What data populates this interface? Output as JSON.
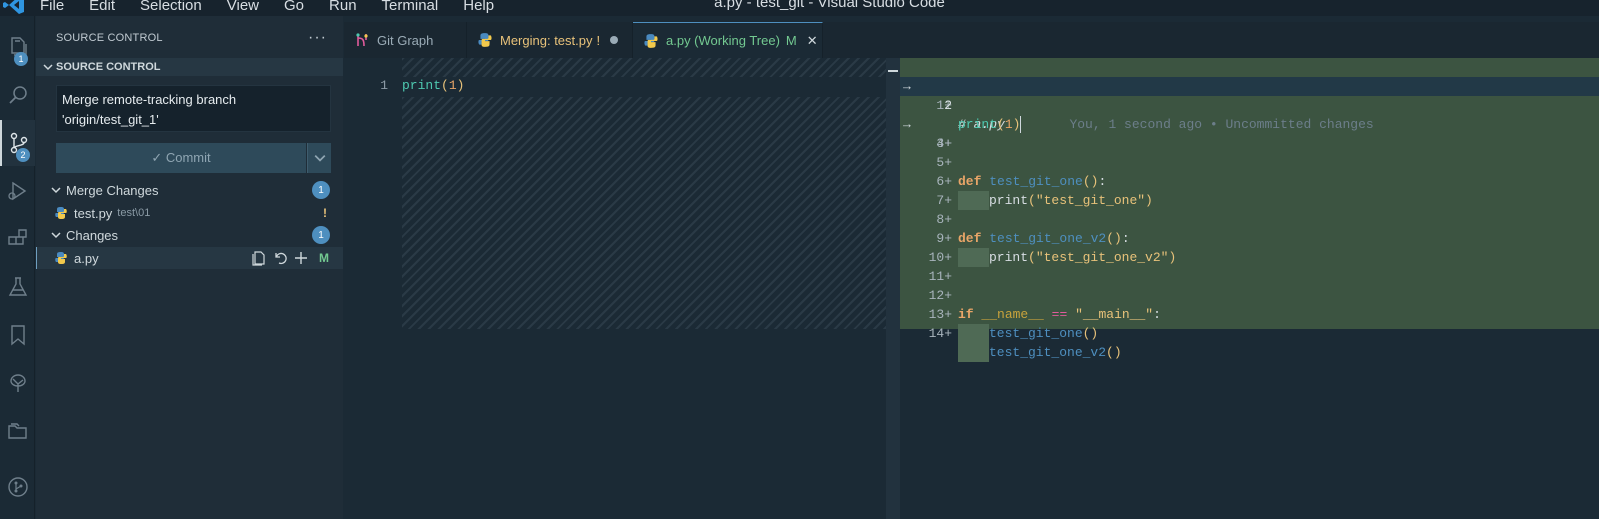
{
  "menu": {
    "items": [
      "File",
      "Edit",
      "Selection",
      "View",
      "Go",
      "Run",
      "Terminal",
      "Help"
    ],
    "window_title": "a.py - test_git - Visual Studio Code"
  },
  "activity_bar": {
    "explorer_badge": "1",
    "source_control_badge": "2"
  },
  "sidebar": {
    "header": "SOURCE CONTROL",
    "more_label": "···",
    "section_title": "SOURCE CONTROL",
    "commit_message": "Merge remote-tracking branch 'origin/test_git_1'",
    "commit_button_label": "✓ Commit",
    "merge_changes": {
      "label": "Merge Changes",
      "count": "1",
      "files": [
        {
          "name": "test.py",
          "path": "test\\01",
          "status": "!"
        }
      ]
    },
    "changes": {
      "label": "Changes",
      "count": "1",
      "files": [
        {
          "name": "a.py",
          "status": "M"
        }
      ]
    }
  },
  "tabs": [
    {
      "label": "Git Graph",
      "active": false
    },
    {
      "label": "Merging: test.py",
      "suffix": "!",
      "active": false,
      "dirty": true
    },
    {
      "label": "a.py (Working Tree)",
      "suffix": "M",
      "active": true
    }
  ],
  "editor": {
    "left": {
      "lines": [
        {
          "number": "1",
          "code": "print(1)"
        }
      ]
    },
    "right": {
      "blame": "You, 1 second ago • Uncommitted changes",
      "lines": [
        {
          "number": "1+",
          "code": "# a.py",
          "arrow": true
        },
        {
          "number": "2",
          "code": "print(1)"
        },
        {
          "number": "3+",
          "code": "",
          "arrow": true
        },
        {
          "number": "4+",
          "code": ""
        },
        {
          "number": "5+",
          "code": "def test_git_one():"
        },
        {
          "number": "6+",
          "code": "    print(\"test_git_one\")"
        },
        {
          "number": "7+",
          "code": ""
        },
        {
          "number": "8+",
          "code": "def test_git_one_v2():"
        },
        {
          "number": "9+",
          "code": "    print(\"test_git_one_v2\")"
        },
        {
          "number": "10+",
          "code": ""
        },
        {
          "number": "11+",
          "code": ""
        },
        {
          "number": "12+",
          "code": "if __name__ == \"__main__\":"
        },
        {
          "number": "13+",
          "code": "    test_git_one()"
        },
        {
          "number": "14+",
          "code": "    test_git_one_v2()"
        }
      ]
    }
  },
  "colors": {
    "accent": "#4e8fbf",
    "added_background": "#3c5441",
    "modified": "#73c991",
    "conflict": "#e8c27a"
  }
}
